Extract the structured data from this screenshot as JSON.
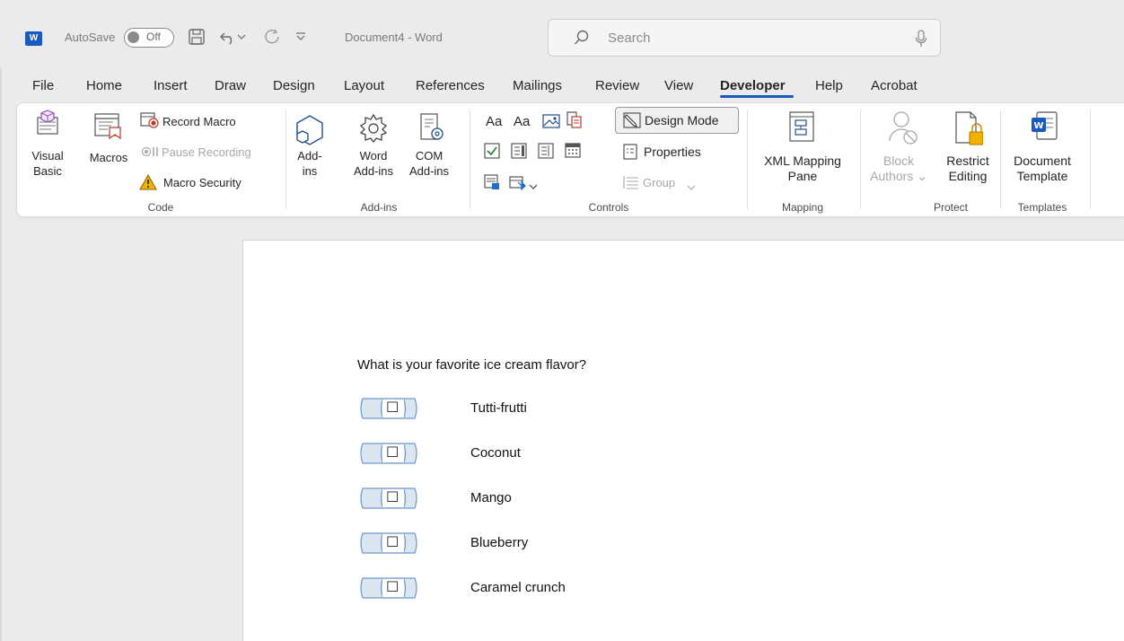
{
  "window": {
    "app_icon": "word-logo",
    "autosave_label": "AutoSave",
    "autosave_state": "Off",
    "document_title": "Document4  -  Word",
    "search_placeholder": "Search"
  },
  "menu_tabs": [
    "File",
    "Home",
    "Insert",
    "Draw",
    "Design",
    "Layout",
    "References",
    "Mailings",
    "Review",
    "View",
    "Developer",
    "Help",
    "Acrobat"
  ],
  "active_tab": "Developer",
  "ribbon": {
    "code": {
      "group_label": "Code",
      "visual_basic": [
        "Visual",
        "Basic"
      ],
      "macros": "Macros",
      "record_macro": "Record Macro",
      "pause_recording": "Pause Recording",
      "macro_security": "Macro Security"
    },
    "addins": {
      "group_label": "Add-ins",
      "addins": [
        "Add-",
        "ins"
      ],
      "word_addins": [
        "Word",
        "Add-ins"
      ],
      "com_addins": [
        "COM",
        "Add-ins"
      ]
    },
    "controls": {
      "group_label": "Controls",
      "aa1": "Aa",
      "aa2": "Aa",
      "design_mode": "Design Mode",
      "properties": "Properties",
      "group": "Group"
    },
    "mapping": {
      "group_label": "Mapping",
      "xml_mapping_pane": [
        "XML Mapping",
        "Pane"
      ]
    },
    "protect": {
      "group_label": "Protect",
      "block_authors": [
        "Block",
        "Authors"
      ],
      "restrict_editing": [
        "Restrict",
        "Editing"
      ]
    },
    "templates": {
      "group_label": "Templates",
      "document_template": [
        "Document",
        "Template"
      ]
    }
  },
  "document": {
    "question": "What is your favorite ice cream flavor?",
    "checkbox_symbol": "☐",
    "options": [
      {
        "label": "Tutti-frutti",
        "checked": false
      },
      {
        "label": "Coconut",
        "checked": false
      },
      {
        "label": "Mango",
        "checked": false
      },
      {
        "label": "Blueberry",
        "checked": false
      },
      {
        "label": "Caramel crunch",
        "checked": false
      }
    ]
  },
  "colors": {
    "accent": "#185abd",
    "content_control_fill": "#dce6f1",
    "content_control_border": "#6f9ad0"
  }
}
